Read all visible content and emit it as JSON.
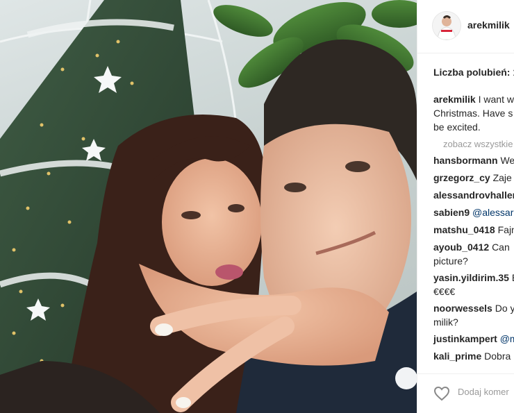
{
  "post": {
    "username": "arekmilik",
    "likes_label": "Liczba polubień: 1",
    "caption": {
      "user": "arekmilik",
      "line1": "I want w",
      "line2": "Christmas. Have s",
      "line3": "be excited."
    },
    "view_all": "zobacz wszystkie",
    "comments": [
      {
        "user": "hansbormann",
        "text": "We"
      },
      {
        "user": "grzegorz_cy",
        "text": "Zaje"
      },
      {
        "user": "alessandrovhaller",
        "text": ""
      },
      {
        "user": "sabien9",
        "text": "@alessar"
      },
      {
        "user": "matshu_0418",
        "text": "Fajn"
      },
      {
        "user": "ayoub_0412",
        "text": "Can",
        "line2": "picture?"
      },
      {
        "user": "yasin.yildirim.35",
        "text": "Be",
        "line2": "€€€€"
      },
      {
        "user": "noorwessels",
        "text": "Do y",
        "line2": "milik?"
      },
      {
        "user": "justinkampert",
        "text": "@m"
      },
      {
        "user": "kali_prime",
        "text": "Dobra"
      }
    ],
    "add_comment_placeholder": "Dodaj komer"
  },
  "icons": {
    "heart": "heart-outline-icon",
    "avatar": "profile-avatar"
  },
  "colors": {
    "text": "#262626",
    "muted": "#999999",
    "border": "#efefef"
  }
}
